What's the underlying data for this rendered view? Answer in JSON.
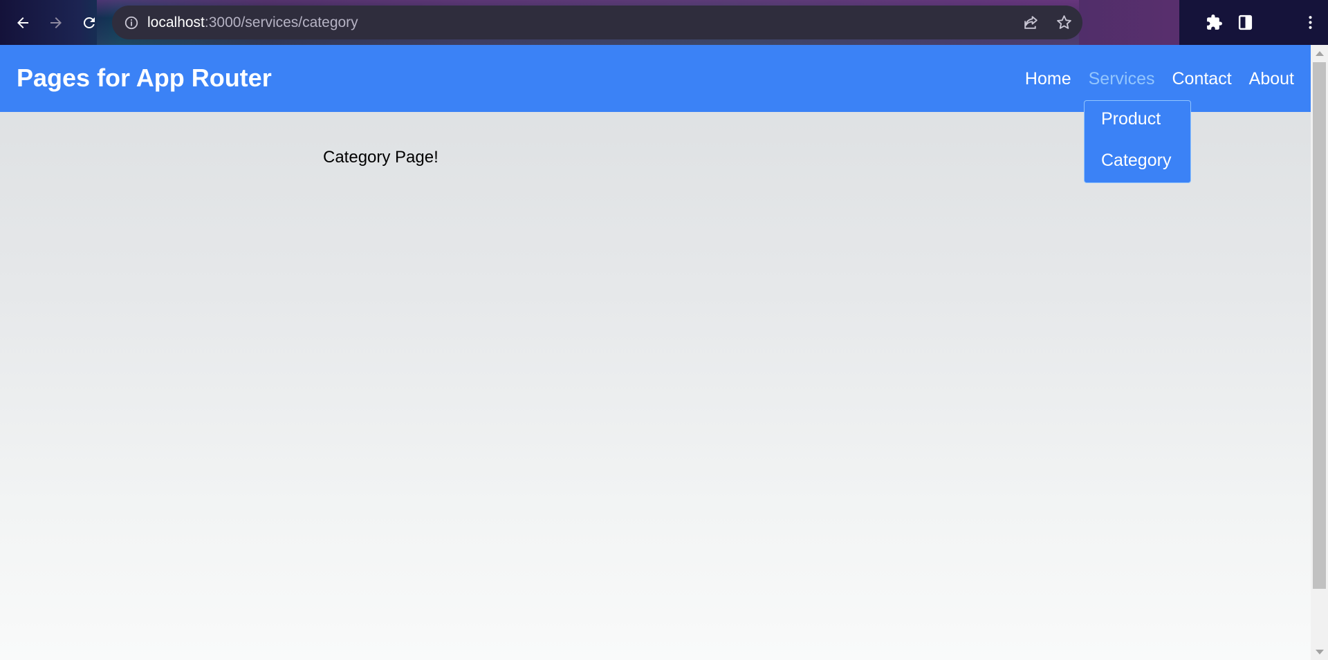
{
  "browser": {
    "url_host": "localhost",
    "url_path": ":3000/services/category",
    "icons": [
      "back-icon",
      "forward-icon",
      "reload-icon",
      "info-icon",
      "share-icon",
      "star-icon",
      "extensions-icon",
      "sidepanel-icon",
      "menu-icon"
    ]
  },
  "site": {
    "title": "Pages for App Router",
    "nav": [
      "Home",
      "Services",
      "Contact",
      "About"
    ],
    "active_nav": "Services",
    "dropdown": [
      "Product",
      "Category"
    ],
    "accent_color": "#3b82f6",
    "active_link_color": "#93c5fd"
  },
  "page": {
    "content": "Category Page!"
  }
}
